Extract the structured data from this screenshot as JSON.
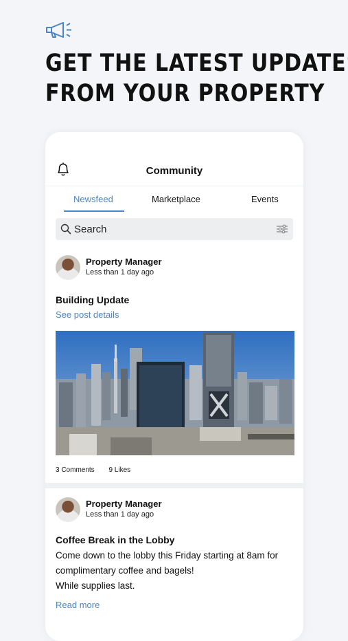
{
  "promo": {
    "icon": "megaphone-icon",
    "headline_line1": "GET THE LATEST UPDATES",
    "headline_line2": "FROM YOUR PROPERTY"
  },
  "app": {
    "title": "Community",
    "tabs": [
      {
        "label": "Newsfeed",
        "active": true
      },
      {
        "label": "Marketplace",
        "active": false
      },
      {
        "label": "Events",
        "active": false
      }
    ],
    "search": {
      "placeholder": "Search"
    },
    "accent_color": "#4a86c5"
  },
  "feed": {
    "posts": [
      {
        "author": "Property Manager",
        "time": "Less than 1 day ago",
        "title": "Building Update",
        "link": "See post details",
        "comments": "3 Comments",
        "likes": "9 Likes"
      },
      {
        "author": "Property Manager",
        "time": "Less than 1 day ago",
        "title": "Coffee Break in the Lobby",
        "body": [
          "Come down to the lobby this Friday starting at 8am for",
          "complimentary coffee and bagels!",
          "While supplies last."
        ],
        "link": "Read more"
      }
    ]
  }
}
